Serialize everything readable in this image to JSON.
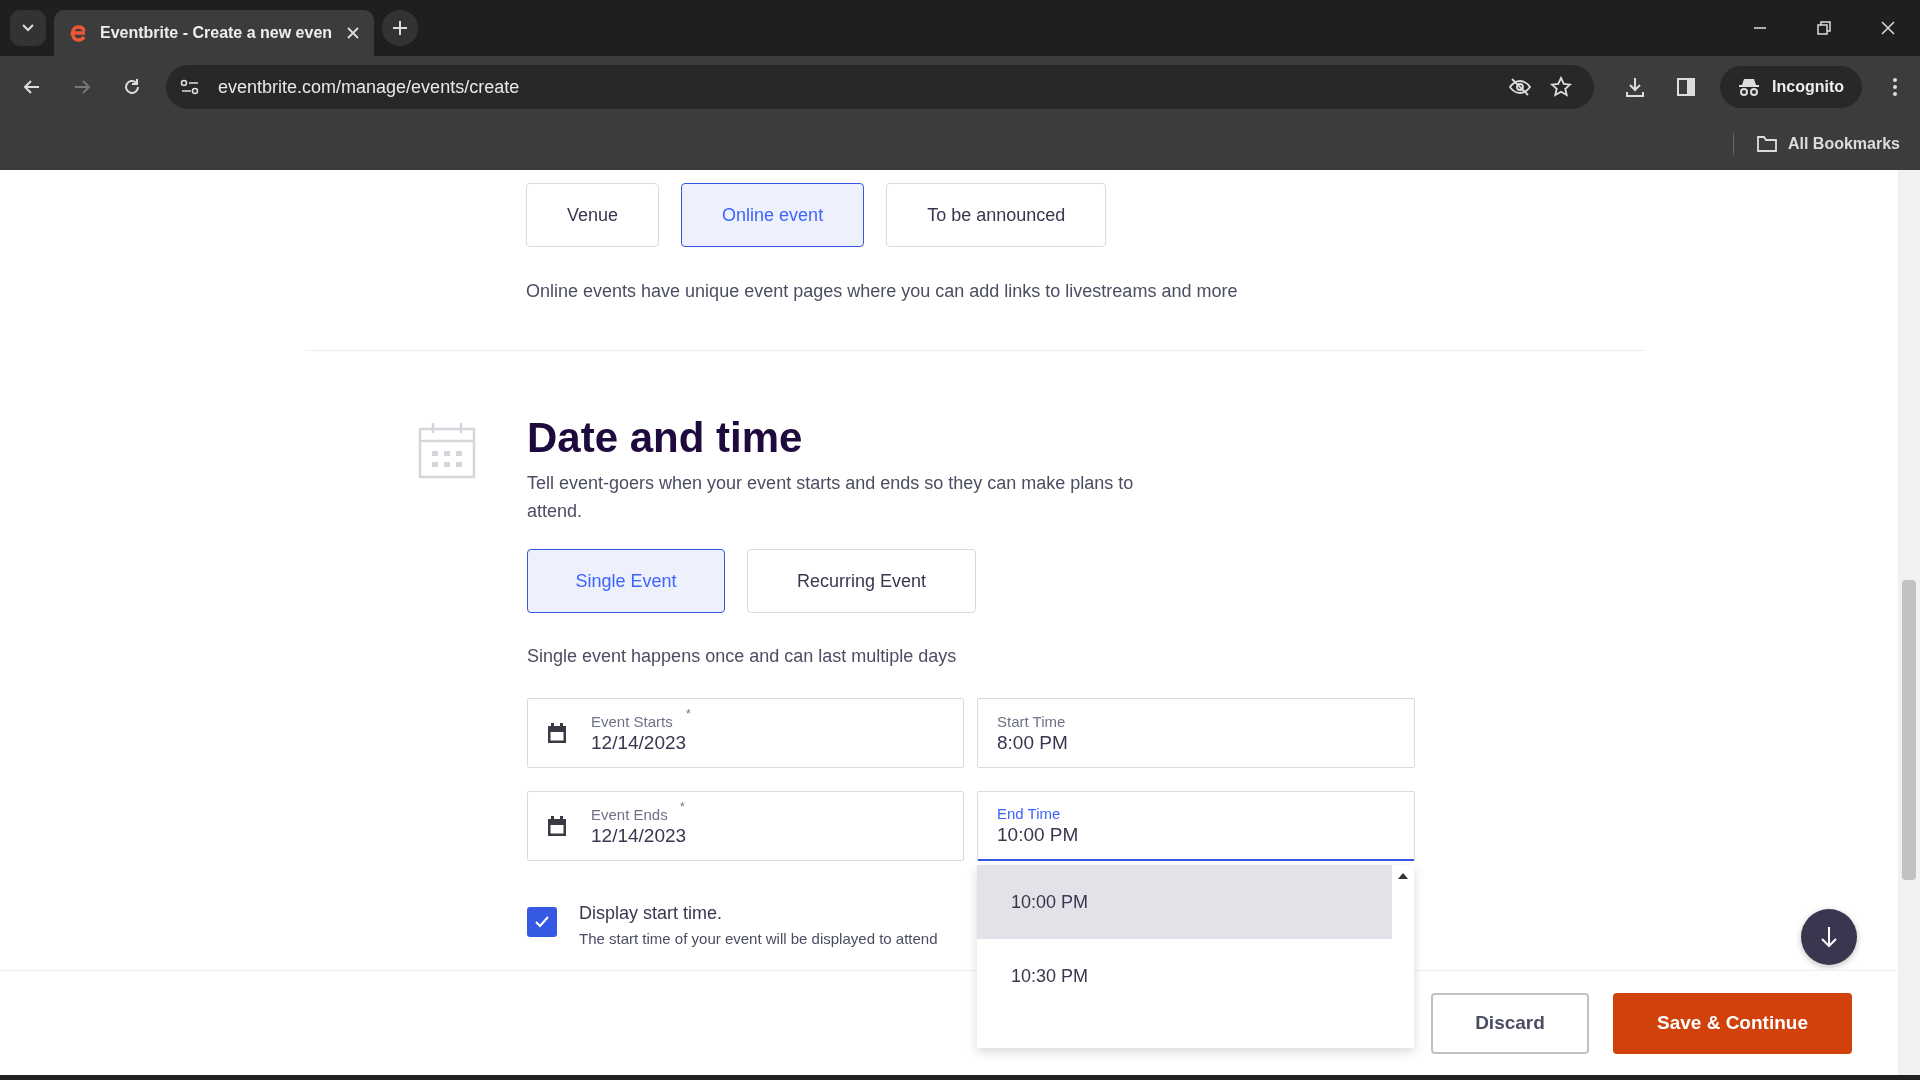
{
  "browser": {
    "tab_title": "Eventbrite - Create a new even",
    "url": "eventbrite.com/manage/events/create",
    "profile": "Incognito",
    "bookmarks": "All Bookmarks"
  },
  "location": {
    "options": [
      {
        "label": "Venue",
        "selected": false
      },
      {
        "label": "Online event",
        "selected": true
      },
      {
        "label": "To be announced",
        "selected": false
      }
    ],
    "description": "Online events have unique event pages where you can add links to livestreams and more"
  },
  "date_time": {
    "title": "Date and time",
    "subtitle": "Tell event-goers when your event starts and ends so they can make plans to attend.",
    "types": [
      {
        "label": "Single Event",
        "selected": true
      },
      {
        "label": "Recurring Event",
        "selected": false
      }
    ],
    "required_mark": "*",
    "type_description": "Single event happens once and can last multiple days",
    "fields": [
      {
        "kind": "date",
        "label": "Event Starts",
        "required": true,
        "value": "12/14/2023",
        "focused": false
      },
      {
        "kind": "time",
        "label": "Start Time",
        "required": false,
        "value": "8:00 PM",
        "focused": false
      },
      {
        "kind": "date",
        "label": "Event Ends",
        "required": true,
        "value": "12/14/2023",
        "focused": false
      },
      {
        "kind": "time",
        "label": "End Time",
        "required": false,
        "value": "10:00 PM",
        "focused": true
      }
    ],
    "time_options": [
      {
        "label": "10:00 PM",
        "selected": true
      },
      {
        "label": "10:30 PM",
        "selected": false
      }
    ],
    "display_start_time": {
      "checked": true,
      "label": "Display start time.",
      "hint": "The start time of your event will be displayed to attend"
    }
  },
  "footer": {
    "buttons": [
      "Discard",
      "Save & Continue"
    ]
  }
}
